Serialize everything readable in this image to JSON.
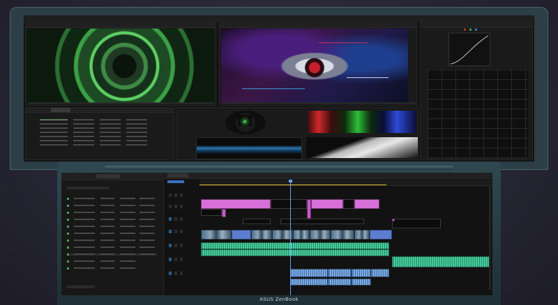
{
  "brand": {
    "label": "ASUS ZenBook"
  },
  "colors": {
    "lid": "#2c3e46",
    "deck": "#2f4852",
    "clip_pink": "#d66fd8",
    "clip_audio": "#3fbf93",
    "clip_audio_blue": "#6f9fd6",
    "playhead": "#6ea0ff"
  },
  "icons": {
    "speaker_thumbnail": "speaker-cone-image",
    "robot_thumbnail": "cyborg-face-image"
  }
}
